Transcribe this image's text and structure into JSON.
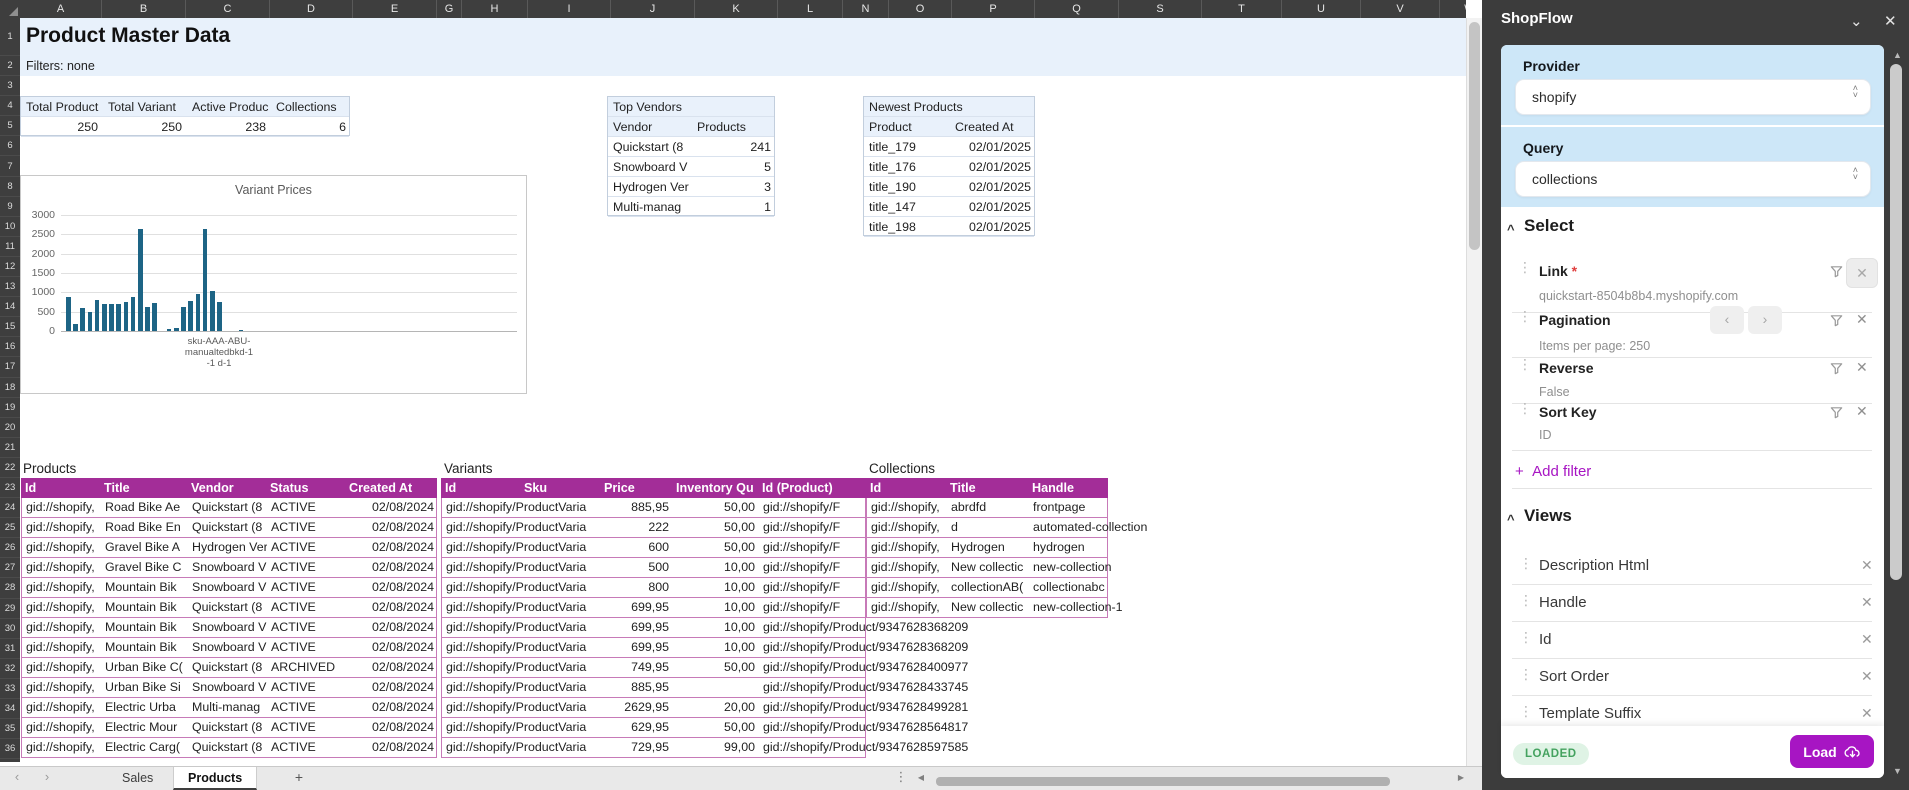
{
  "sheet": {
    "title": "Product Master Data",
    "filters_text": "Filters: none",
    "columns": [
      "A",
      "B",
      "C",
      "D",
      "E",
      "G",
      "H",
      "I",
      "J",
      "K",
      "L",
      "N",
      "O",
      "P",
      "Q",
      "S",
      "T",
      "U",
      "V",
      "W"
    ],
    "row_count": 37,
    "summary": {
      "headers": [
        "Total Product",
        "Total Variant",
        "Active Produc",
        "Collections"
      ],
      "values": [
        "250",
        "250",
        "238",
        "6"
      ]
    },
    "top_vendors": {
      "title": "Top Vendors",
      "headers": [
        "Vendor",
        "Products"
      ],
      "rows": [
        [
          "Quickstart (8",
          "241"
        ],
        [
          "Snowboard V",
          "5"
        ],
        [
          "Hydrogen Ver",
          "3"
        ],
        [
          "Multi-manag",
          "1"
        ]
      ]
    },
    "newest_products": {
      "title": "Newest Products",
      "headers": [
        "Product",
        "Created At"
      ],
      "rows": [
        [
          "title_179",
          "02/01/2025"
        ],
        [
          "title_176",
          "02/01/2025"
        ],
        [
          "title_190",
          "02/01/2025"
        ],
        [
          "title_147",
          "02/01/2025"
        ],
        [
          "title_198",
          "02/01/2025"
        ]
      ]
    },
    "products_table": {
      "label": "Products",
      "headers": [
        "Id",
        "Title",
        "Vendor",
        "Status",
        "Created At"
      ],
      "rows": [
        [
          "gid://shopify,",
          "Road Bike Ae",
          "Quickstart (8",
          "ACTIVE",
          "02/08/2024"
        ],
        [
          "gid://shopify,",
          "Road Bike En",
          "Quickstart (8",
          "ACTIVE",
          "02/08/2024"
        ],
        [
          "gid://shopify,",
          "Gravel Bike A",
          "Hydrogen Ver",
          "ACTIVE",
          "02/08/2024"
        ],
        [
          "gid://shopify,",
          "Gravel Bike C",
          "Snowboard V",
          "ACTIVE",
          "02/08/2024"
        ],
        [
          "gid://shopify,",
          "Mountain Bik",
          "Snowboard V",
          "ACTIVE",
          "02/08/2024"
        ],
        [
          "gid://shopify,",
          "Mountain Bik",
          "Quickstart (8",
          "ACTIVE",
          "02/08/2024"
        ],
        [
          "gid://shopify,",
          "Mountain Bik",
          "Snowboard V",
          "ACTIVE",
          "02/08/2024"
        ],
        [
          "gid://shopify,",
          "Mountain Bik",
          "Snowboard V",
          "ACTIVE",
          "02/08/2024"
        ],
        [
          "gid://shopify,",
          "Urban Bike C(",
          "Quickstart (8",
          "ARCHIVED",
          "02/08/2024"
        ],
        [
          "gid://shopify,",
          "Urban Bike Si",
          "Snowboard V",
          "ACTIVE",
          "02/08/2024"
        ],
        [
          "gid://shopify,",
          "Electric Urba",
          "Multi-manag",
          "ACTIVE",
          "02/08/2024"
        ],
        [
          "gid://shopify,",
          "Electric Mour",
          "Quickstart (8",
          "ACTIVE",
          "02/08/2024"
        ],
        [
          "gid://shopify,",
          "Electric Carg(",
          "Quickstart (8",
          "ACTIVE",
          "02/08/2024"
        ]
      ]
    },
    "variants_table": {
      "label": "Variants",
      "headers": [
        "Id",
        "Sku",
        "Price",
        "Inventory Qu",
        "Id (Product)"
      ],
      "rows": [
        [
          "gid://shopify/ProductVaria",
          "",
          "885,95",
          "50,00",
          "gid://shopify/F"
        ],
        [
          "gid://shopify/ProductVaria",
          "",
          "222",
          "50,00",
          "gid://shopify/F"
        ],
        [
          "gid://shopify/ProductVaria",
          "",
          "600",
          "50,00",
          "gid://shopify/F"
        ],
        [
          "gid://shopify/ProductVaria",
          "",
          "500",
          "10,00",
          "gid://shopify/F"
        ],
        [
          "gid://shopify/ProductVaria",
          "",
          "800",
          "10,00",
          "gid://shopify/F"
        ],
        [
          "gid://shopify/ProductVaria",
          "",
          "699,95",
          "10,00",
          "gid://shopify/F"
        ],
        [
          "gid://shopify/ProductVaria",
          "",
          "699,95",
          "10,00",
          "gid://shopify/Product/9347628368209"
        ],
        [
          "gid://shopify/ProductVaria",
          "",
          "699,95",
          "10,00",
          "gid://shopify/Product/9347628368209"
        ],
        [
          "gid://shopify/ProductVaria",
          "",
          "749,95",
          "50,00",
          "gid://shopify/Product/9347628400977"
        ],
        [
          "gid://shopify/ProductVaria",
          "",
          "885,95",
          "",
          "gid://shopify/Product/9347628433745"
        ],
        [
          "gid://shopify/ProductVaria",
          "",
          "2629,95",
          "20,00",
          "gid://shopify/Product/9347628499281"
        ],
        [
          "gid://shopify/ProductVaria",
          "",
          "629,95",
          "50,00",
          "gid://shopify/Product/9347628564817"
        ],
        [
          "gid://shopify/ProductVaria",
          "",
          "729,95",
          "99,00",
          "gid://shopify/Product/9347628597585"
        ]
      ]
    },
    "collections_table": {
      "label": "Collections",
      "headers": [
        "Id",
        "Title",
        "Handle"
      ],
      "rows": [
        [
          "gid://shopify,",
          "abrdfd",
          "frontpage"
        ],
        [
          "gid://shopify,",
          "d",
          "automated-collection"
        ],
        [
          "gid://shopify,",
          "Hydrogen",
          "hydrogen"
        ],
        [
          "gid://shopify,",
          "New collectic",
          "new-collection"
        ],
        [
          "gid://shopify,",
          "collectionAB(",
          "collectionabc"
        ],
        [
          "gid://shopify,",
          "New collectic",
          "new-collection-1"
        ]
      ]
    },
    "tab_bar": {
      "sheets": [
        "Sales",
        "Products"
      ],
      "active": "Products",
      "add_label": "+"
    }
  },
  "chart_data": {
    "type": "bar",
    "title": "Variant Prices",
    "values": [
      880,
      180,
      600,
      500,
      800,
      700,
      700,
      700,
      750,
      880,
      2630,
      630,
      730,
      0,
      40,
      80,
      630,
      780,
      950,
      2630,
      1030,
      750,
      0,
      0,
      30
    ],
    "ylim": [
      0,
      3000
    ],
    "yticks": [
      0,
      500,
      1000,
      1500,
      2000,
      2500,
      3000
    ],
    "x_axis_label_lines": [
      "sku-AAA-ABU-",
      "manualtedbkd-1",
      "-1 d-1"
    ],
    "xlabel": "",
    "ylabel": "",
    "grid": true,
    "legend": "none",
    "bar_color": "#1d6485"
  },
  "sidebar": {
    "title": "ShopFlow",
    "provider": {
      "label": "Provider",
      "value": "shopify"
    },
    "query": {
      "label": "Query",
      "value": "collections"
    },
    "select_section": {
      "label": "Select",
      "fields": [
        {
          "name": "Link",
          "required": true,
          "value": "quickstart-8504b8b4.myshopify.com",
          "nav": false,
          "boxed_close": true
        },
        {
          "name": "Pagination",
          "required": false,
          "value": "Items per page: 250",
          "nav": true,
          "boxed_close": false
        },
        {
          "name": "Reverse",
          "required": false,
          "value": "False",
          "nav": false,
          "boxed_close": false
        },
        {
          "name": "Sort Key",
          "required": false,
          "value": "ID",
          "nav": false,
          "boxed_close": false
        }
      ],
      "add_filter_label": "Add filter"
    },
    "views_section": {
      "label": "Views",
      "items": [
        "Description Html",
        "Handle",
        "Id",
        "Sort Order",
        "Template Suffix"
      ]
    },
    "footer": {
      "status": "LOADED",
      "load_label": "Load"
    }
  },
  "colors": {
    "table_header": "#a32d98",
    "row_border": "#c77ab8",
    "accent_purple": "#a715c3",
    "chrome_dark": "#3d3d3d",
    "band_blue": "#e8f1fb",
    "sidebar_blue": "#cde7f8",
    "bar_color": "#1d6485",
    "status_green": "#44a25f"
  }
}
